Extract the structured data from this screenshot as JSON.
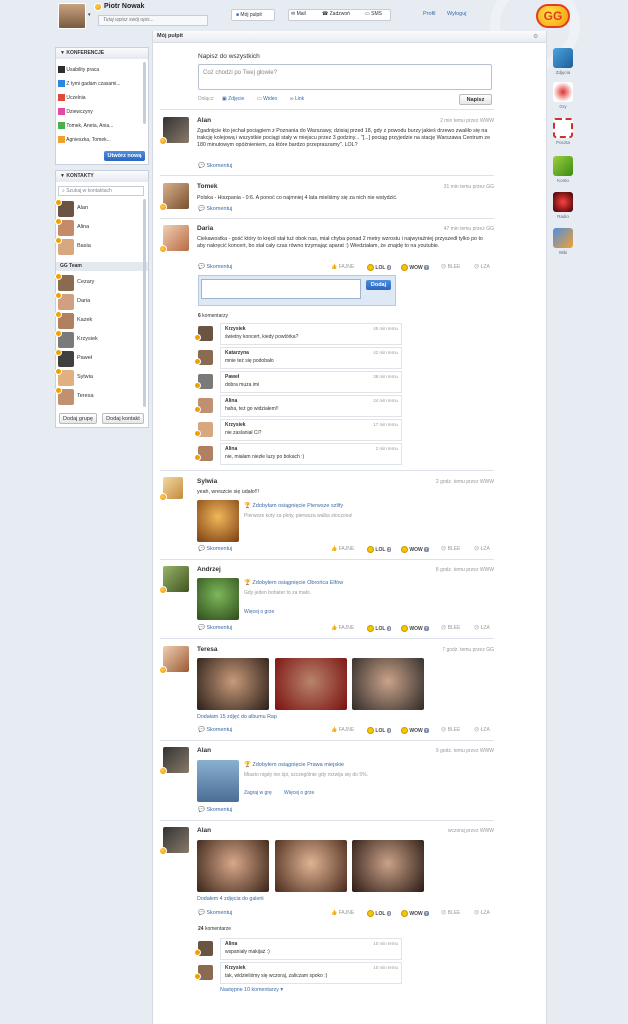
{
  "header": {
    "user_name": "Piotr Nowak",
    "status_placeholder": "Tutaj wpisz swój opis...",
    "nav": [
      "Mój pulpit",
      "Mail",
      "Zadzwoń",
      "SMS"
    ],
    "profil": "Profil",
    "logout": "Wyloguj",
    "logo": "GG"
  },
  "konferencje": {
    "title": "KONFERENCJE",
    "items": [
      "Usability praca",
      "Z tymi gadam czasami...",
      "Uczelnia",
      "Dziewczyny",
      "Tomek, Aneta, Ania...",
      "Agnieszka, Tomek..."
    ],
    "button": "Utwórz nową"
  },
  "kontakty": {
    "title": "KONTAKTY",
    "search_placeholder": "Szukaj w kontaktach",
    "top": [
      "Alan",
      "Alina",
      "Basia"
    ],
    "group": "GG Team",
    "members": [
      "Cezary",
      "Daria",
      "Kazek",
      "Krzysiek",
      "Paweł",
      "Sylwia",
      "Teresa"
    ],
    "add_group": "Dodaj grupę",
    "add_contact": "Dodaj kontakt"
  },
  "main": {
    "title": "Mój pulpit",
    "compose_title": "Napisz do wszystkich",
    "compose_placeholder": "Coż chodzi po Twej głowie?",
    "attach_label": "Dołącz:",
    "attach": [
      "Zdjęcie",
      "Wideo",
      "Link"
    ],
    "submit": "Napisz"
  },
  "reactions": {
    "fajne": "FAJNE",
    "lol": "LOL",
    "wow": "WOW",
    "blee": "BLEE",
    "lza": "ŁZA",
    "comment": "Skomentuj"
  },
  "posts": [
    {
      "name": "Alan",
      "time": "2 min temu przez WWW",
      "text": "Zgadnijcie kto jechał pociągiem z Poznania do Warszawy, dzisiaj przed 18, gdy z powodu burzy jakieś drzewo zwaliło się na trakcję kolejową i wszystkie pociągi stały w miejscu przez 3 godziny... \"[...] pociąg przyjedzie na stację Warszawa Centrum ze 180 minutowym opóźnieniem, za które bardzo przepraszamy\". LOL?"
    },
    {
      "name": "Tomek",
      "time": "31 min temu przez GG",
      "text": "Polska - Hiszpania - 0:6. A ponoć co najmniej 4 lata mieliśmy się za nich nie wstydzić."
    },
    {
      "name": "Daria",
      "time": "47 min temu przez GG",
      "text": "Ciekawostka - gość który to kręcił stał tuż obok nas, miał chyba ponad 2 metry wzrostu i najwyraźniej przyszedł tylko po to aby nakręcić koncert, bo stał cały czas równo trzymając aparat :) Wiedziałam, że znajdę to na youtubie.",
      "reply_button": "Dodaj",
      "lol": "3",
      "wow": "7",
      "comments_count": "6",
      "comments_label": "komentarzy",
      "comments": [
        {
          "name": "Krzysiek",
          "text": "świetny koncert, kiedy powtórka?",
          "time": "45 min temu"
        },
        {
          "name": "Katarzyna",
          "text": "mnie też się podobało",
          "time": "42 min temu"
        },
        {
          "name": "Paweł",
          "text": "dobra muza imi",
          "time": "38 min temu"
        },
        {
          "name": "Alina",
          "text": "haha, też go widziałem!!",
          "time": "24 min temu"
        },
        {
          "name": "Krzysiek",
          "text": "nie zaslaniał Ci?",
          "time": "17 min temu"
        },
        {
          "name": "Alina",
          "text": "nie, miałam niezłe luzy po bokach :)",
          "time": "2 min temu"
        }
      ]
    },
    {
      "name": "Sylwia",
      "time": "2 godz. temu przez WWW",
      "text": "yeah, wreszcie się udało!!!",
      "ach_title": "Zdobyłam osiągnięcie Pierwsze szlify",
      "ach_desc": "Pierwsze koty za płoty, pierwsza walka stoczona!",
      "lol": "3",
      "wow": "7"
    },
    {
      "name": "Andrzej",
      "time": "8 godz. temu przez WWW",
      "ach_title": "Zdobyłem osiągnięcie Obrońca Elfów",
      "ach_desc": "Gdy jeden bohater to za mało.",
      "more": "Więcej o grze",
      "lol": "3",
      "wow": "7"
    },
    {
      "name": "Teresa",
      "time": "7 godz. temu przez GG",
      "album": "Dodałam 15 zdjęć do albumu Rap",
      "lol": "3",
      "wow": "7"
    },
    {
      "name": "Alan",
      "time": "9 godz. temu przez WWW",
      "ach_title": "Zdobyłem osiągnięcie Prawa miejskie",
      "ach_desc": "Miasto nigdy nie śpi, szczególnie gdy rozwija się do 5%.",
      "play": "Zagraj w grę",
      "more": "Więcej o grze"
    },
    {
      "name": "Alan",
      "time": "wczoraj przez WWW",
      "album": "Dodałem 4 zdjęcia do galerii",
      "lol": "3",
      "wow": "7",
      "comments_count": "24",
      "comments_label": "komentarze",
      "comments": [
        {
          "name": "Alina",
          "text": "wspaniały makijaż :)",
          "time": "10 min temu"
        },
        {
          "name": "Krzysiek",
          "text": "tak, widzieliśmy się wczoraj, zaliczam spoko :)",
          "time": "10 min temu"
        }
      ],
      "next": "Następne 10 komentarzy ▾"
    }
  ],
  "apps": [
    "Zdjęcia",
    "Gry",
    "Poczta",
    "Konto",
    "Radio",
    "Wiki"
  ]
}
